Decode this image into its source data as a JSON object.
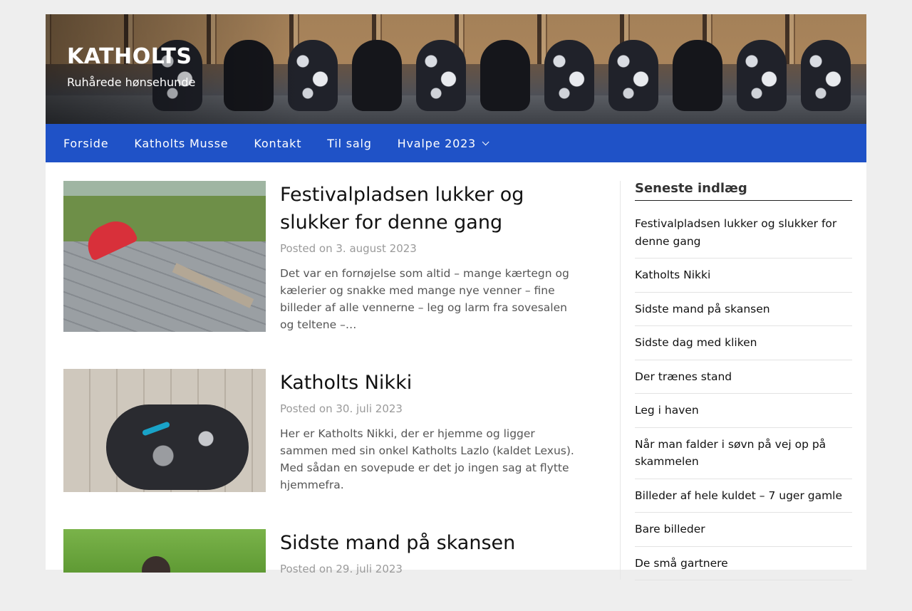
{
  "site": {
    "title": "KATHOLTS",
    "tagline": "Ruhårede hønsehunde"
  },
  "nav": {
    "items": [
      {
        "label": "Forside"
      },
      {
        "label": "Katholts Musse"
      },
      {
        "label": "Kontakt"
      },
      {
        "label": "Til salg"
      },
      {
        "label": "Hvalpe 2023",
        "has_dropdown": true
      }
    ]
  },
  "posts": [
    {
      "title": "Festivalpladsen lukker og slukker for denne gang",
      "meta_prefix": "Posted on",
      "date": "3. august 2023",
      "excerpt": "Det var en fornøjelse som altid  – mange kærtegn og kælerier og snakke med mange nye venner – fine billeder af alle vennerne – leg og larm fra sovesalen og teltene –…"
    },
    {
      "title": "Katholts Nikki",
      "meta_prefix": "Posted on",
      "date": "30. juli 2023",
      "excerpt": "Her er Katholts Nikki, der er hjemme og ligger sammen med sin onkel Katholts Lazlo (kaldet Lexus). Med sådan en sovepude er det jo ingen sag at flytte hjemmefra."
    },
    {
      "title": "Sidste mand på skansen",
      "meta_prefix": "Posted on",
      "date": "29. juli 2023",
      "excerpt": ""
    }
  ],
  "sidebar": {
    "widget_title": "Seneste indlæg",
    "recent": [
      "Festivalpladsen lukker og slukker for denne gang",
      "Katholts Nikki",
      "Sidste mand på skansen",
      "Sidste dag med kliken",
      "Der trænes stand",
      "Leg i haven",
      "Når man falder i søvn på vej op på skammelen",
      "Billeder af hele kuldet – 7 uger gamle",
      "Bare billeder",
      "De små gartnere"
    ]
  },
  "colors": {
    "nav_bg": "#1f52c7",
    "page_bg": "#eeeeee",
    "meta_text": "#9a9a9a"
  }
}
